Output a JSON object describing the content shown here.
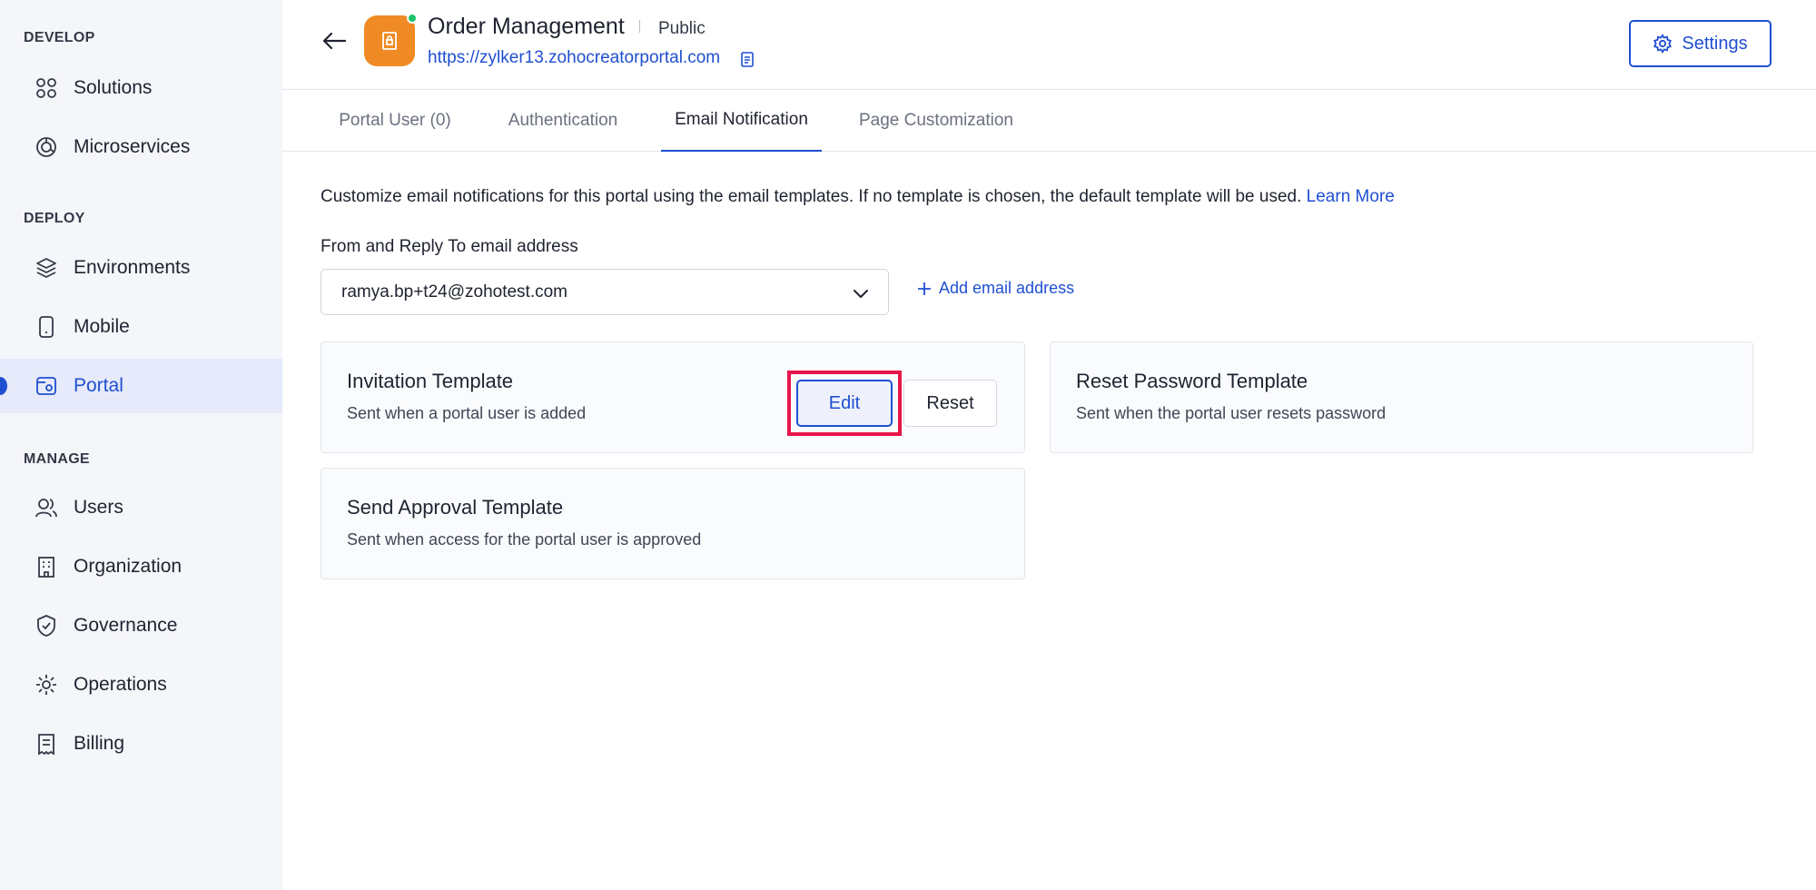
{
  "sidebar": {
    "sections": [
      {
        "title": "DEVELOP",
        "items": [
          {
            "label": "Solutions",
            "icon": "grid-icon"
          },
          {
            "label": "Microservices",
            "icon": "microservices-icon"
          }
        ]
      },
      {
        "title": "DEPLOY",
        "items": [
          {
            "label": "Environments",
            "icon": "layers-icon"
          },
          {
            "label": "Mobile",
            "icon": "mobile-icon"
          },
          {
            "label": "Portal",
            "icon": "portal-icon",
            "active": true
          }
        ]
      },
      {
        "title": "MANAGE",
        "items": [
          {
            "label": "Users",
            "icon": "users-icon"
          },
          {
            "label": "Organization",
            "icon": "building-icon"
          },
          {
            "label": "Governance",
            "icon": "shield-icon"
          },
          {
            "label": "Operations",
            "icon": "gear-icon"
          },
          {
            "label": "Billing",
            "icon": "receipt-icon"
          }
        ]
      }
    ]
  },
  "header": {
    "title": "Order Management",
    "visibility": "Public",
    "url": "https://zylker13.zohocreatorportal.com",
    "settings_label": "Settings"
  },
  "tabs": [
    {
      "label": "Portal User (0)"
    },
    {
      "label": "Authentication"
    },
    {
      "label": "Email Notification",
      "active": true
    },
    {
      "label": "Page Customization"
    }
  ],
  "main": {
    "description": "Customize email notifications for this portal using the email templates. If no template is chosen, the default template will be used.",
    "learn_more": "Learn More",
    "from_label": "From and Reply To email address",
    "from_value": "ramya.bp+t24@zohotest.com",
    "add_email_label": "Add email address",
    "templates": [
      {
        "title": "Invitation Template",
        "subtitle": "Sent when a portal user is added",
        "edit_label": "Edit",
        "reset_label": "Reset"
      },
      {
        "title": "Reset Password Template",
        "subtitle": "Sent when the portal user resets password"
      },
      {
        "title": "Send Approval Template",
        "subtitle": "Sent when access for the portal user is approved"
      }
    ]
  },
  "colors": {
    "accent": "#1f4fd1",
    "app_icon": "#f08a24",
    "highlight": "#e8154a",
    "online": "#1ec26a"
  }
}
